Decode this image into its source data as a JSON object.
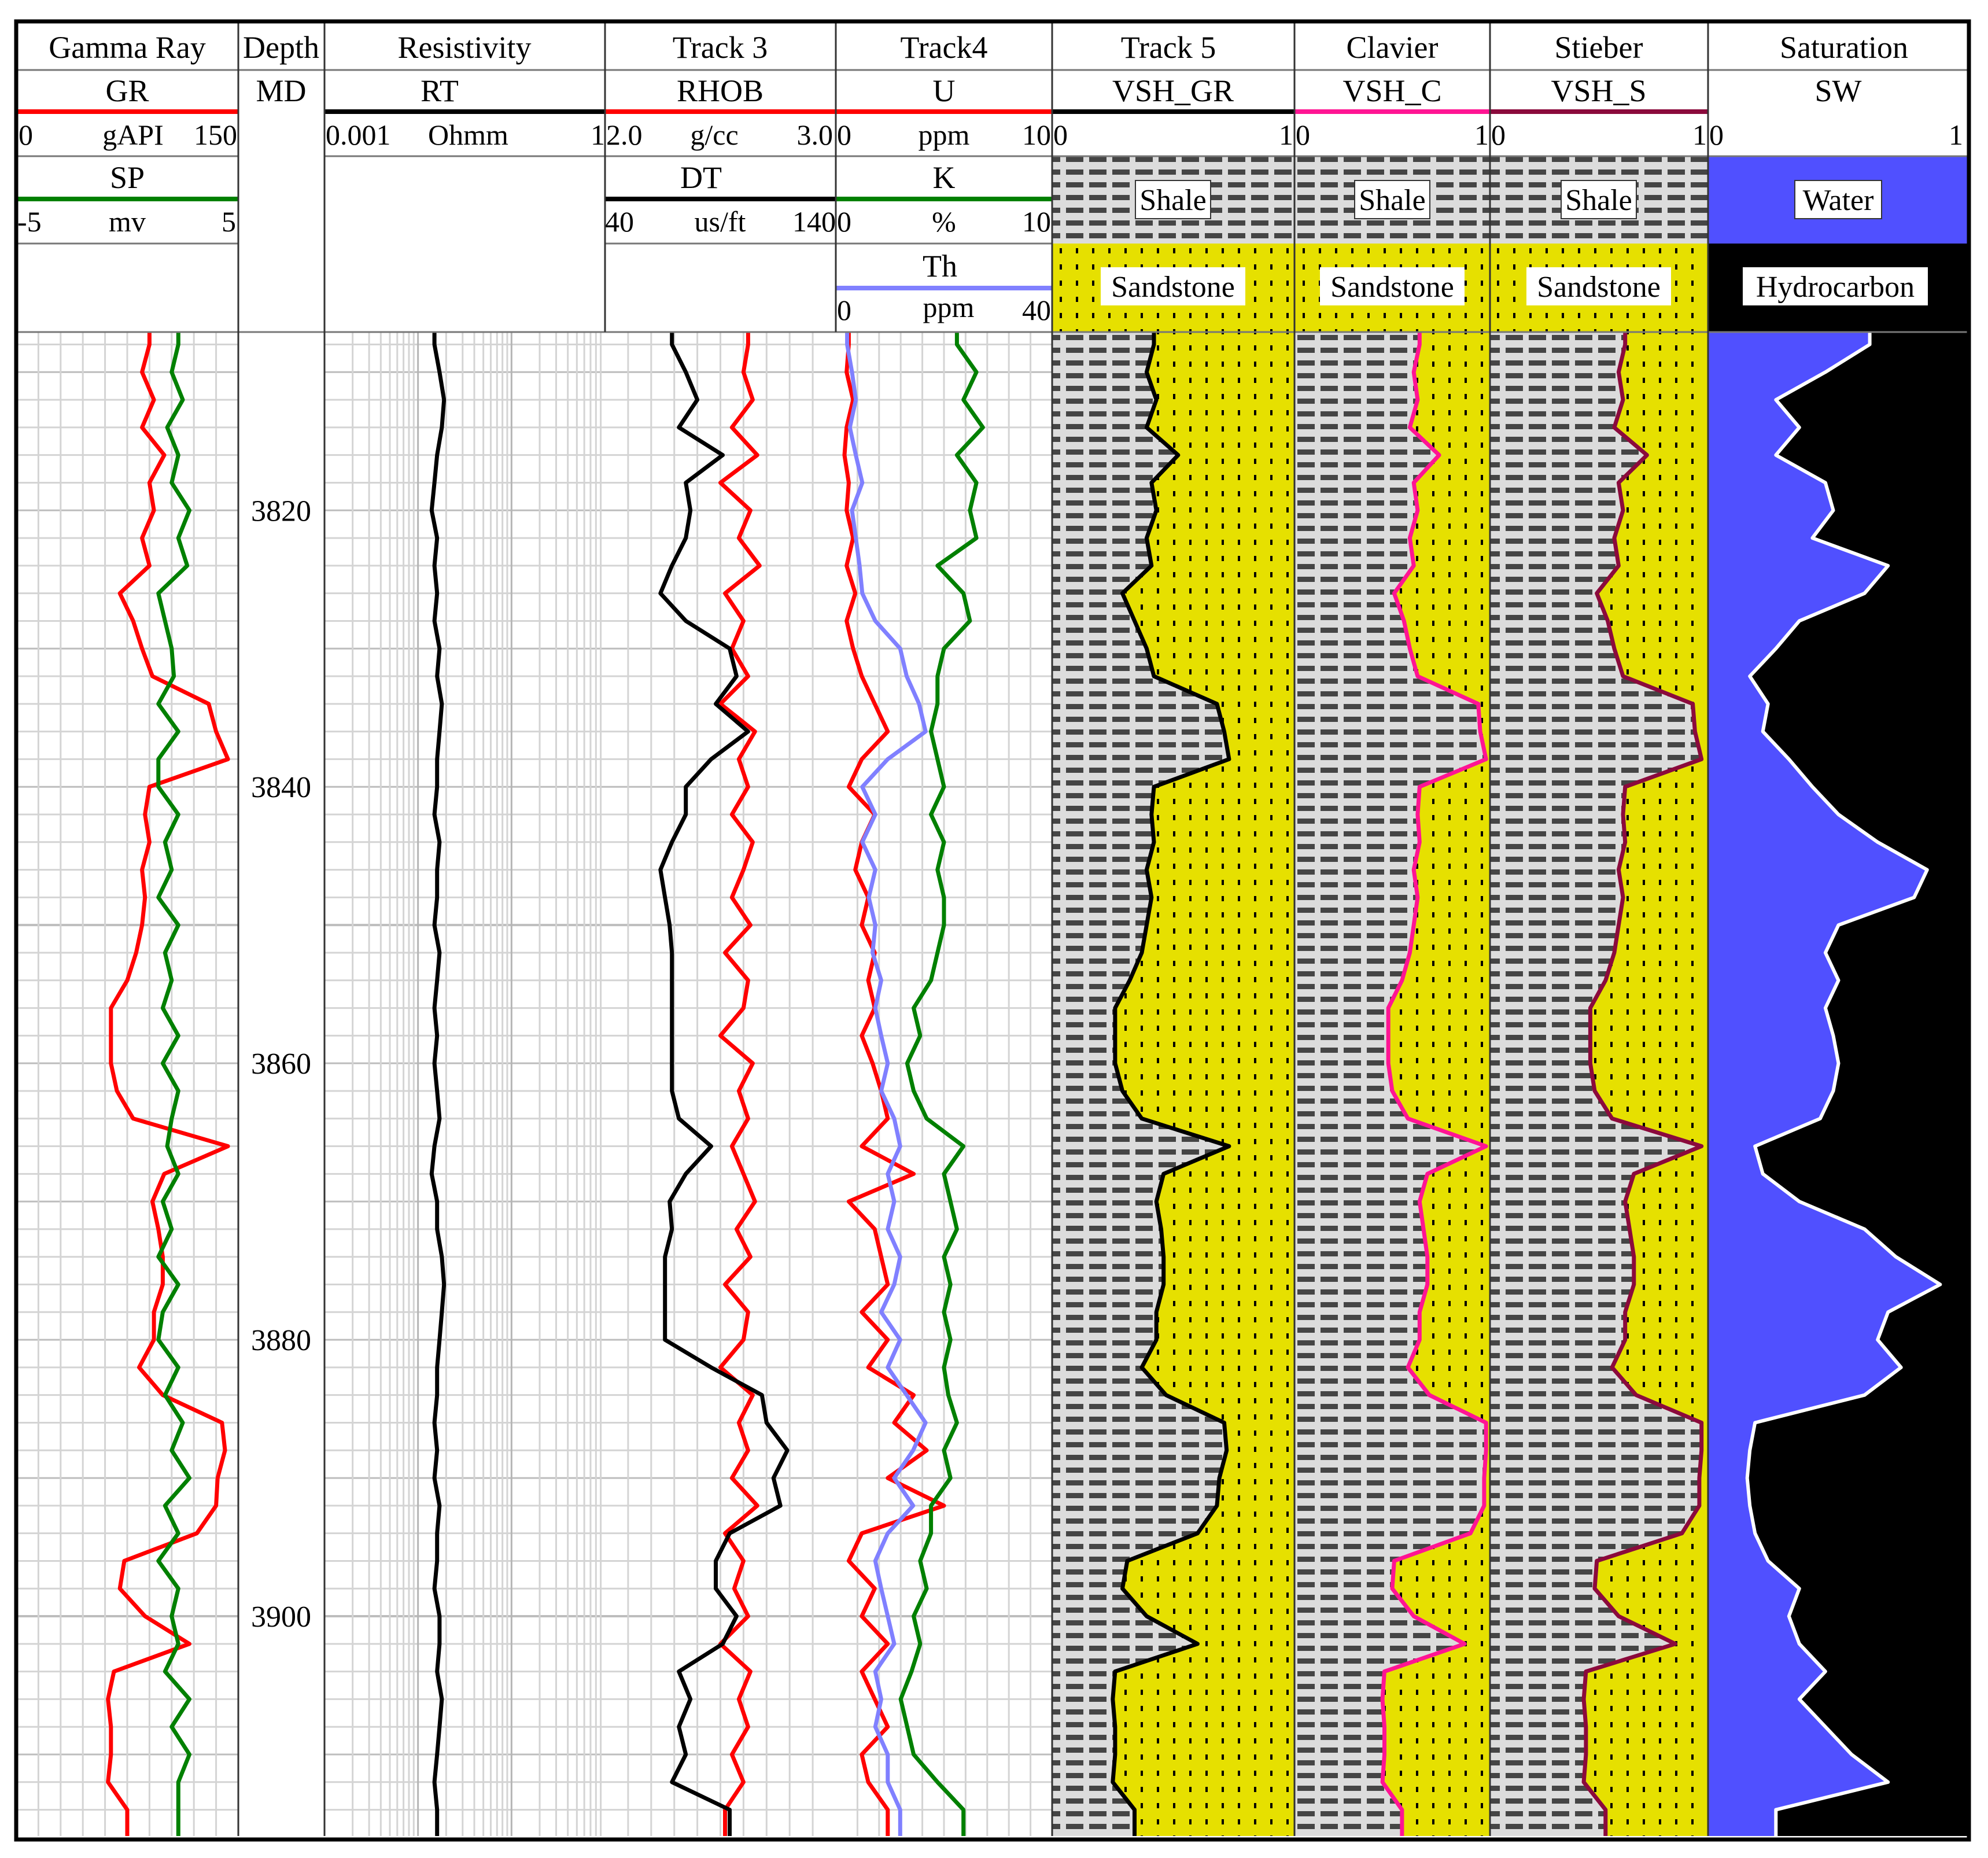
{
  "tracks": {
    "gamma": {
      "title": "Gamma Ray",
      "gr": {
        "mnemonic": "GR",
        "min": "0",
        "unit": "gAPI",
        "max": "150"
      },
      "sp": {
        "mnemonic": "SP",
        "min": "-5",
        "unit": "mv",
        "max": "5"
      }
    },
    "depth": {
      "title": "Depth",
      "mnemonic": "MD"
    },
    "resistivity": {
      "title": "Resistivity",
      "rt": {
        "mnemonic": "RT",
        "min": "0.001",
        "unit": "Ohmm",
        "max": "1"
      }
    },
    "track3": {
      "title": "Track 3",
      "rhob": {
        "mnemonic": "RHOB",
        "min": "2.0",
        "unit": "g/cc",
        "max": "3.0"
      },
      "dt": {
        "mnemonic": "DT",
        "min": "40",
        "unit": "us/ft",
        "max": "140"
      }
    },
    "track4": {
      "title": "Track4",
      "u": {
        "mnemonic": "U",
        "min": "0",
        "unit": "ppm",
        "max": "10"
      },
      "k": {
        "mnemonic": "K",
        "min": "0",
        "unit": "%",
        "max": "10"
      },
      "th": {
        "mnemonic": "Th",
        "min": "0",
        "unit": "ppm",
        "max": "40"
      }
    },
    "track5": {
      "title": "Track 5",
      "mnemonic": "VSH_GR",
      "min": "0",
      "max": "1",
      "upper_label": "Shale",
      "lower_label": "Sandstone"
    },
    "clavier": {
      "title": "Clavier",
      "mnemonic": "VSH_C",
      "min": "0",
      "max": "1",
      "upper_label": "Shale",
      "lower_label": "Sandstone"
    },
    "stieber": {
      "title": "Stieber",
      "mnemonic": "VSH_S",
      "min": "0",
      "max": "1",
      "upper_label": "Shale",
      "lower_label": "Sandstone"
    },
    "saturation": {
      "title": "Saturation",
      "mnemonic": "SW",
      "min": "0",
      "max": "1",
      "upper_label": "Water",
      "lower_label": "Hydrocarbon"
    }
  },
  "depth_labels": [
    "3820",
    "3840",
    "3860",
    "3880",
    "3900"
  ],
  "colors": {
    "red": "#ff0000",
    "green": "#008000",
    "black": "#000000",
    "blue": "#8080ff",
    "pink": "#ff1493",
    "maroon": "#8b0a3c",
    "water": "#5050ff",
    "sand": "#e6e000",
    "shale": "#dcdcdc"
  },
  "chart_data": {
    "type": "line",
    "title": "Well log",
    "ylabel": "MD",
    "depth_range": [
      3807,
      3916
    ],
    "depth_start": 3808,
    "depth_step": 2,
    "curves": [
      {
        "name": "GR",
        "track": "Gamma Ray",
        "min": 0,
        "max": 150,
        "color": "#ff0000",
        "values": [
          90,
          85,
          93,
          85,
          100,
          90,
          93,
          85,
          90,
          70,
          79,
          85,
          92,
          130,
          135,
          143,
          90,
          87,
          90,
          85,
          87,
          85,
          81,
          75,
          64,
          64,
          64,
          68,
          79,
          143,
          100,
          92,
          96,
          99,
          99,
          93,
          93,
          83,
          99,
          139,
          141,
          136,
          135,
          122,
          73,
          70,
          87,
          117,
          66,
          62,
          64,
          64,
          62,
          75
        ]
      },
      {
        "name": "SP",
        "track": "Gamma Ray",
        "min": -5,
        "max": 5,
        "color": "#008000",
        "values": [
          2.3,
          2.0,
          2.5,
          1.8,
          2.3,
          2.0,
          2.8,
          2.3,
          2.7,
          1.4,
          1.7,
          2.0,
          2.1,
          1.4,
          2.3,
          1.4,
          1.4,
          2.3,
          1.7,
          2.0,
          1.4,
          2.3,
          1.7,
          2.0,
          1.6,
          2.3,
          1.6,
          2.3,
          2.0,
          1.8,
          2.3,
          1.6,
          2.0,
          1.4,
          2.3,
          1.6,
          1.4,
          2.3,
          1.7,
          2.5,
          2.0,
          2.8,
          1.7,
          2.3,
          1.4,
          2.3,
          2.0,
          2.3,
          1.7,
          2.8,
          2.0,
          2.8,
          2.3,
          2.3
        ]
      },
      {
        "name": "RT",
        "track": "Resistivity",
        "min": 0.001,
        "max": 1,
        "log": true,
        "color": "#000000",
        "values": [
          0.015,
          0.017,
          0.019,
          0.018,
          0.016,
          0.015,
          0.014,
          0.016,
          0.015,
          0.016,
          0.015,
          0.017,
          0.016,
          0.018,
          0.017,
          0.016,
          0.016,
          0.015,
          0.017,
          0.016,
          0.016,
          0.015,
          0.017,
          0.016,
          0.015,
          0.016,
          0.015,
          0.016,
          0.017,
          0.015,
          0.014,
          0.016,
          0.016,
          0.018,
          0.019,
          0.018,
          0.017,
          0.016,
          0.016,
          0.015,
          0.016,
          0.015,
          0.017,
          0.016,
          0.016,
          0.015,
          0.017,
          0.017,
          0.016,
          0.018,
          0.017,
          0.016,
          0.015,
          0.016
        ]
      },
      {
        "name": "RHOB",
        "track": "Track 3",
        "min": 2.0,
        "max": 3.0,
        "color": "#ff0000",
        "values": [
          2.62,
          2.6,
          2.64,
          2.55,
          2.66,
          2.5,
          2.63,
          2.58,
          2.67,
          2.52,
          2.6,
          2.55,
          2.62,
          2.5,
          2.65,
          2.58,
          2.62,
          2.55,
          2.64,
          2.6,
          2.55,
          2.63,
          2.52,
          2.62,
          2.6,
          2.5,
          2.64,
          2.58,
          2.62,
          2.55,
          2.6,
          2.65,
          2.57,
          2.63,
          2.52,
          2.62,
          2.6,
          2.5,
          2.64,
          2.58,
          2.62,
          2.55,
          2.66,
          2.52,
          2.6,
          2.56,
          2.62,
          2.5,
          2.63,
          2.58,
          2.62,
          2.55,
          2.6,
          2.52
        ]
      },
      {
        "name": "DT",
        "track": "Track 3",
        "min": 40,
        "max": 140,
        "color": "#000000",
        "values": [
          69,
          75,
          80,
          72,
          91,
          75,
          77,
          75,
          69,
          64,
          75,
          94,
          97,
          88,
          102,
          86,
          75,
          75,
          69,
          64,
          66,
          68,
          69,
          69,
          69,
          69,
          69,
          69,
          72,
          86,
          75,
          68,
          69,
          66,
          66,
          66,
          66,
          86,
          108,
          110,
          119,
          113,
          116,
          94,
          88,
          88,
          97,
          91,
          72,
          77,
          72,
          75,
          69,
          94
        ]
      },
      {
        "name": "U",
        "track": "Track4",
        "min": 0,
        "max": 10,
        "color": "#ff0000",
        "values": [
          0.6,
          0.5,
          0.8,
          0.5,
          0.4,
          0.6,
          0.5,
          0.8,
          0.5,
          0.9,
          0.5,
          0.8,
          1.2,
          1.8,
          2.4,
          1.2,
          0.6,
          1.8,
          1.2,
          0.9,
          1.5,
          1.2,
          1.8,
          1.5,
          1.8,
          1.2,
          1.7,
          2.1,
          2.4,
          1.2,
          3.6,
          0.6,
          1.8,
          2.1,
          2.4,
          1.2,
          2.4,
          1.5,
          3.6,
          2.7,
          4.2,
          2.4,
          5.0,
          1.2,
          0.6,
          1.8,
          1.2,
          2.4,
          1.2,
          1.8,
          2.4,
          1.2,
          1.5,
          2.4
        ]
      },
      {
        "name": "K",
        "track": "Track4",
        "min": 0,
        "max": 10,
        "color": "#008000",
        "values": [
          5.6,
          6.5,
          5.9,
          6.8,
          5.6,
          6.5,
          6.2,
          6.5,
          4.7,
          5.9,
          6.2,
          5.0,
          4.7,
          4.7,
          4.4,
          4.7,
          5.0,
          4.4,
          5.0,
          4.7,
          5.0,
          5.0,
          4.7,
          4.4,
          3.6,
          3.9,
          3.3,
          3.6,
          4.2,
          5.9,
          5.0,
          5.3,
          5.6,
          5.0,
          5.3,
          5.0,
          5.3,
          5.0,
          5.2,
          5.6,
          5.0,
          5.3,
          4.4,
          4.4,
          3.9,
          4.2,
          3.6,
          3.9,
          3.5,
          3.0,
          3.3,
          3.6,
          4.7,
          5.9
        ]
      },
      {
        "name": "Th",
        "track": "Track4",
        "min": 0,
        "max": 40,
        "color": "#8080ff",
        "values": [
          2.1,
          3.0,
          3.7,
          2.6,
          3.7,
          4.9,
          3.0,
          3.7,
          4.4,
          4.9,
          7.3,
          11.9,
          13.1,
          15.4,
          16.6,
          9.6,
          4.9,
          7.3,
          4.9,
          7.3,
          6.1,
          7.3,
          6.8,
          8.4,
          7.3,
          8.4,
          9.6,
          8.4,
          10.8,
          11.9,
          9.6,
          10.8,
          9.6,
          11.9,
          10.8,
          8.4,
          11.9,
          9.6,
          13.1,
          16.6,
          14.3,
          10.8,
          14.3,
          9.6,
          7.3,
          8.4,
          9.6,
          10.8,
          7.3,
          8.4,
          7.3,
          9.6,
          9.6,
          11.9
        ]
      },
      {
        "name": "VSH_GR",
        "track": "Track 5",
        "min": 0,
        "max": 1,
        "color": "#000000",
        "values": [
          0.42,
          0.39,
          0.43,
          0.39,
          0.52,
          0.41,
          0.43,
          0.39,
          0.41,
          0.29,
          0.34,
          0.39,
          0.42,
          0.68,
          0.71,
          0.73,
          0.42,
          0.41,
          0.42,
          0.39,
          0.41,
          0.39,
          0.37,
          0.32,
          0.26,
          0.26,
          0.26,
          0.29,
          0.37,
          0.73,
          0.46,
          0.43,
          0.45,
          0.46,
          0.46,
          0.43,
          0.43,
          0.37,
          0.47,
          0.71,
          0.72,
          0.69,
          0.68,
          0.6,
          0.31,
          0.29,
          0.39,
          0.6,
          0.26,
          0.25,
          0.26,
          0.26,
          0.25,
          0.34
        ]
      },
      {
        "name": "VSH_C",
        "track": "Clavier",
        "min": 0,
        "max": 1,
        "color": "#ff1493",
        "values": [
          0.64,
          0.61,
          0.63,
          0.59,
          0.74,
          0.61,
          0.63,
          0.59,
          0.61,
          0.51,
          0.56,
          0.59,
          0.63,
          0.94,
          0.95,
          0.98,
          0.64,
          0.63,
          0.64,
          0.61,
          0.63,
          0.61,
          0.59,
          0.55,
          0.48,
          0.48,
          0.48,
          0.5,
          0.58,
          0.98,
          0.68,
          0.64,
          0.66,
          0.68,
          0.68,
          0.64,
          0.64,
          0.58,
          0.69,
          0.98,
          0.98,
          0.97,
          0.97,
          0.9,
          0.51,
          0.5,
          0.61,
          0.87,
          0.46,
          0.45,
          0.46,
          0.46,
          0.45,
          0.55
        ]
      },
      {
        "name": "VSH_S",
        "track": "Stieber",
        "min": 0,
        "max": 1,
        "color": "#8b0a3c",
        "values": [
          0.62,
          0.59,
          0.61,
          0.57,
          0.72,
          0.59,
          0.61,
          0.57,
          0.59,
          0.49,
          0.54,
          0.57,
          0.61,
          0.93,
          0.94,
          0.97,
          0.62,
          0.61,
          0.62,
          0.59,
          0.61,
          0.59,
          0.57,
          0.53,
          0.46,
          0.46,
          0.46,
          0.48,
          0.56,
          0.97,
          0.66,
          0.62,
          0.64,
          0.66,
          0.66,
          0.62,
          0.62,
          0.56,
          0.67,
          0.97,
          0.97,
          0.96,
          0.96,
          0.88,
          0.49,
          0.48,
          0.59,
          0.85,
          0.44,
          0.43,
          0.44,
          0.44,
          0.43,
          0.53
        ]
      },
      {
        "name": "SW",
        "track": "Saturation",
        "min": 0,
        "max": 1,
        "color": "#ffffff",
        "values": [
          0.62,
          0.45,
          0.26,
          0.35,
          0.26,
          0.45,
          0.48,
          0.4,
          0.69,
          0.6,
          0.35,
          0.26,
          0.16,
          0.23,
          0.21,
          0.31,
          0.4,
          0.5,
          0.65,
          0.84,
          0.79,
          0.5,
          0.45,
          0.5,
          0.45,
          0.48,
          0.5,
          0.48,
          0.43,
          0.18,
          0.21,
          0.35,
          0.6,
          0.72,
          0.89,
          0.69,
          0.65,
          0.74,
          0.6,
          0.18,
          0.16,
          0.15,
          0.16,
          0.18,
          0.23,
          0.35,
          0.31,
          0.35,
          0.45,
          0.35,
          0.45,
          0.55,
          0.69,
          0.26
        ]
      }
    ]
  }
}
